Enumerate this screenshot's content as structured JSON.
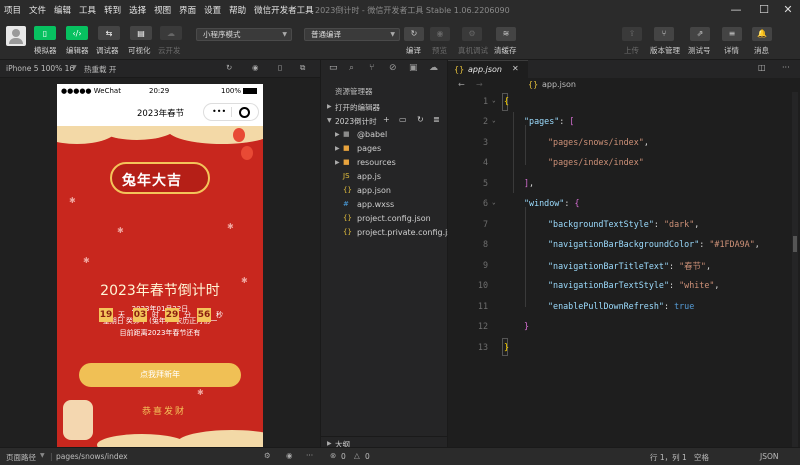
{
  "menu": [
    "项目",
    "文件",
    "编辑",
    "工具",
    "转到",
    "选择",
    "视图",
    "界面",
    "设置",
    "帮助",
    "微信开发者工具"
  ],
  "window_title": "2023倒计时 - 微信开发者工具 Stable 1.06.2206090",
  "toolbar": {
    "simulator_label": "模拟器",
    "editor_label": "编辑器",
    "debugger_label": "调试器",
    "visual_label": "可视化",
    "cloud_label": "云开发",
    "mode_select": "小程序模式",
    "compile_select": "普通编译",
    "compile_label": "编译",
    "preview_label": "预览",
    "realdevice_label": "真机调试",
    "clearcache_label": "清缓存",
    "upload_label": "上传",
    "version_label": "版本管理",
    "testid_label": "测试号",
    "details_label": "详情",
    "messages_label": "消息"
  },
  "simulator": {
    "device": "iPhone 5 100% 16",
    "hotreload": "热重载 开",
    "status": {
      "carrier": "●●●●● WeChat",
      "time": "20:29",
      "battery": "100%"
    },
    "nav_title": "2023年春节",
    "badge": "兔年大吉",
    "headline": "2023年春节倒计时",
    "date_line": "2023年01月22日",
    "lunar_line": "星期日 癸卯年 (兔年)   农历正月初一",
    "remain_line": "目前距离2023年春节还有",
    "countdown": {
      "days": "19",
      "days_unit": "天",
      "hours": "03",
      "hours_unit": "时",
      "minutes": "29",
      "minutes_unit": "分",
      "seconds": "56",
      "seconds_unit": "秒"
    },
    "button": "点我拜新年",
    "blessing": "恭喜发财"
  },
  "explorer": {
    "title": "资源管理器",
    "open_editors": "打开的编辑器",
    "project": "2023倒计时",
    "items": [
      "@babel",
      "pages",
      "resources",
      "app.js",
      "app.json",
      "app.wxss",
      "project.config.json",
      "project.private.config.js..."
    ],
    "outline": "大纲"
  },
  "editor": {
    "tab": "app.json",
    "breadcrumb": "app.json",
    "lines": [
      "1",
      "2",
      "3",
      "4",
      "5",
      "6",
      "7",
      "8",
      "9",
      "10",
      "11",
      "12",
      "13"
    ],
    "code": {
      "pages_key": "\"pages\"",
      "page1": "\"pages/snows/index\"",
      "page2": "\"pages/index/index\"",
      "window_key": "\"window\"",
      "bts_key": "\"backgroundTextStyle\"",
      "bts_val": "\"dark\"",
      "nbbc_key": "\"navigationBarBackgroundColor\"",
      "nbbc_val": "\"#1FDA9A\"",
      "nbtt_key": "\"navigationBarTitleText\"",
      "nbtt_val": "\"春节\"",
      "nbts_key": "\"navigationBarTextStyle\"",
      "nbts_val": "\"white\"",
      "epdr_key": "\"enablePullDownRefresh\"",
      "epdr_val": "true"
    }
  },
  "statusbar": {
    "path_label": "页面路径",
    "path": "pages/snows/index",
    "errors": "0",
    "warnings": "0",
    "position": "行 1，列 1",
    "encoding": "空格",
    "lang": "JSON"
  }
}
